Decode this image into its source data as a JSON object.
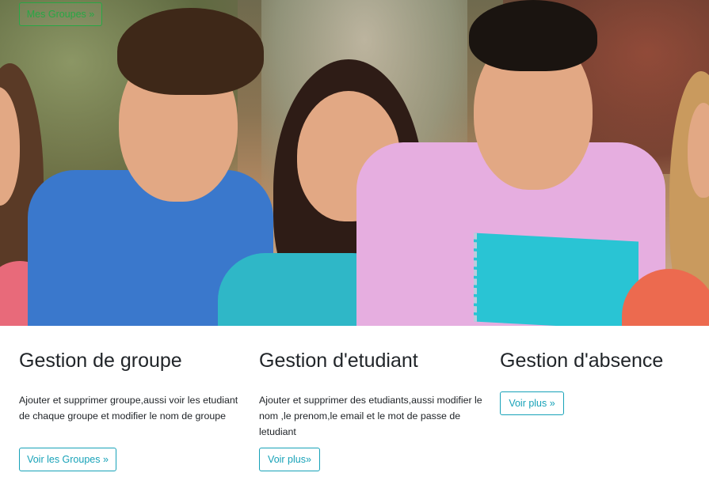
{
  "hero": {
    "mes_groupes_label": "Mes Groupes »"
  },
  "cards": [
    {
      "title": "Gestion de groupe",
      "text": "Ajouter et supprimer groupe,aussi voir les etudiant de chaque groupe et modifier le nom de groupe",
      "button_label": "Voir les Groupes »"
    },
    {
      "title": "Gestion d'etudiant",
      "text": "Ajouter et supprimer des etudiants,aussi modifier le nom ,le prenom,le email et le mot de passe de letudiant",
      "button_label": "Voir plus»"
    },
    {
      "title": "Gestion d'absence",
      "text": "",
      "button_label": "Voir plus »"
    }
  ],
  "colors": {
    "success": "#28a745",
    "info": "#17a2b8",
    "text": "#212529"
  }
}
